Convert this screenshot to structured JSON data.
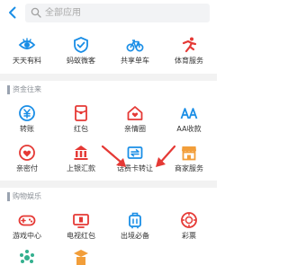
{
  "search": {
    "placeholder": "全部应用"
  },
  "top_apps": [
    {
      "label": "天天有料",
      "icon": "eye-icon"
    },
    {
      "label": "蚂蚁微客",
      "icon": "shield-check-icon"
    },
    {
      "label": "共享单车",
      "icon": "bicycle-icon"
    },
    {
      "label": "体育服务",
      "icon": "running-man-icon"
    }
  ],
  "sections": [
    {
      "title": "资金往来",
      "apps": [
        {
          "label": "转账",
          "icon": "yuan-transfer-icon"
        },
        {
          "label": "红包",
          "icon": "red-envelope-icon"
        },
        {
          "label": "亲情圈",
          "icon": "house-icon"
        },
        {
          "label": "AA收款",
          "icon": "aa-icon"
        },
        {
          "label": "亲密付",
          "icon": "heart-icon"
        },
        {
          "label": "上银汇款",
          "icon": "bank-remit-icon"
        },
        {
          "label": "话费卡转让",
          "icon": "card-transfer-icon"
        },
        {
          "label": "商家服务",
          "icon": "shop-icon"
        }
      ]
    },
    {
      "title": "购物娱乐",
      "apps": [
        {
          "label": "游戏中心",
          "icon": "gamepad-icon"
        },
        {
          "label": "电视红包",
          "icon": "tv-envelope-icon"
        },
        {
          "label": "出境必备",
          "icon": "luggage-icon"
        },
        {
          "label": "彩票",
          "icon": "lottery-icon"
        }
      ]
    }
  ],
  "colors": {
    "brand_blue": "#1a8ee6",
    "red": "#e53935",
    "orange": "#f29e3a",
    "teal": "#34b08f"
  }
}
